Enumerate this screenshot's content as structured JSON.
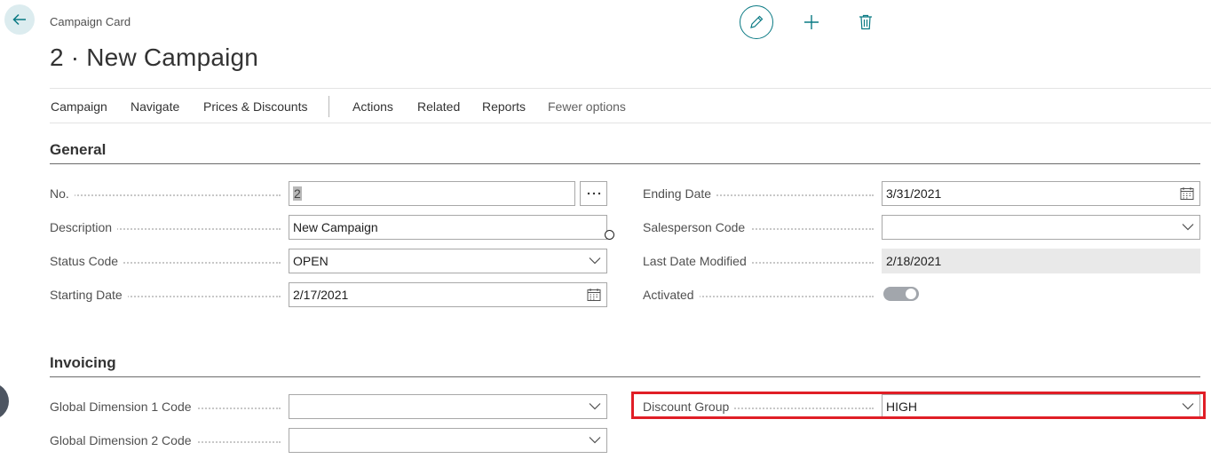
{
  "header": {
    "caption": "Campaign Card",
    "title": "2 · New Campaign"
  },
  "icons": {
    "back": "arrow-left-icon",
    "edit": "pencil-icon",
    "new": "plus-icon",
    "delete": "trash-icon",
    "lookup": "ellipsis-icon",
    "dropdown": "chevron-down-icon",
    "date": "calendar-icon"
  },
  "colors": {
    "accent": "#0a7a84",
    "highlight": "#e01e26",
    "toggle": "#a2a6ac"
  },
  "action_bar": {
    "items": [
      "Campaign",
      "Navigate",
      "Prices & Discounts",
      "Actions",
      "Related",
      "Reports",
      "Fewer options"
    ]
  },
  "general": {
    "title": "General",
    "no": {
      "label": "No.",
      "value": "2"
    },
    "description": {
      "label": "Description",
      "value": "New Campaign"
    },
    "status_code": {
      "label": "Status Code",
      "value": "OPEN"
    },
    "starting_date": {
      "label": "Starting Date",
      "value": "2/17/2021"
    },
    "ending_date": {
      "label": "Ending Date",
      "value": "3/31/2021"
    },
    "salesperson_code": {
      "label": "Salesperson Code",
      "value": ""
    },
    "last_date_modified": {
      "label": "Last Date Modified",
      "value": "2/18/2021"
    },
    "activated": {
      "label": "Activated",
      "value": true
    }
  },
  "invoicing": {
    "title": "Invoicing",
    "global_dim_1": {
      "label": "Global Dimension 1 Code",
      "value": ""
    },
    "global_dim_2": {
      "label": "Global Dimension 2 Code",
      "value": ""
    },
    "discount_group": {
      "label": "Discount Group",
      "value": "HIGH"
    }
  }
}
